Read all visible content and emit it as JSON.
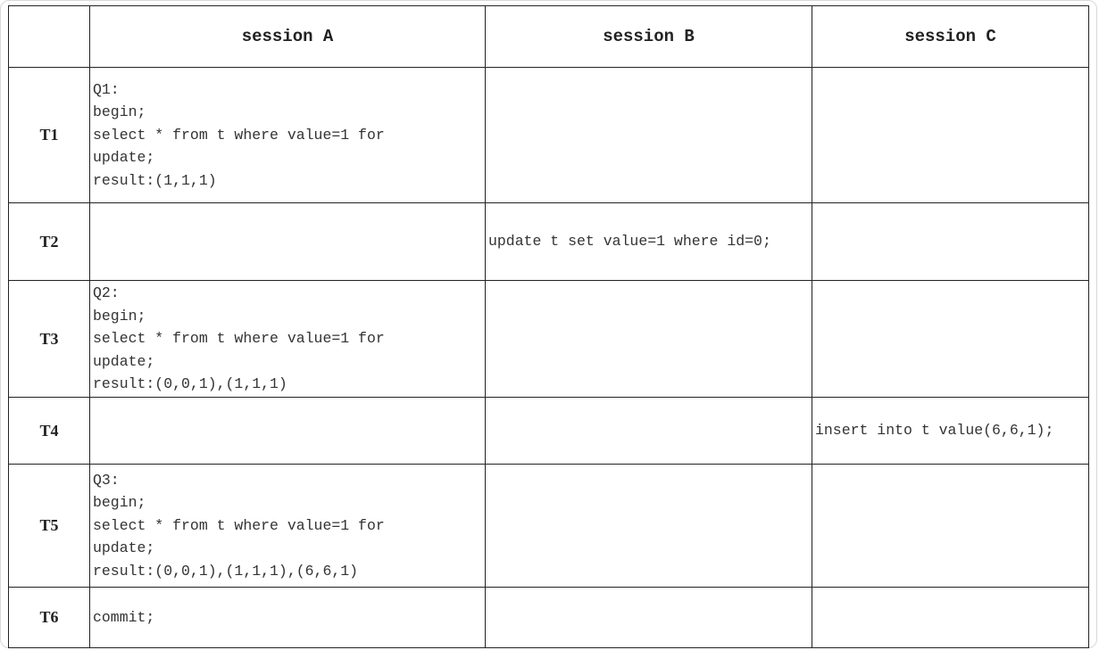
{
  "headers": [
    "",
    "session A",
    "session B",
    "session C"
  ],
  "rows": [
    {
      "time": "T1",
      "a": "Q1:\nbegin;\nselect * from t where value=1 for\nupdate;\nresult:(1,1,1)",
      "b": "",
      "c": ""
    },
    {
      "time": "T2",
      "a": "",
      "b": "update t set value=1 where id=0;",
      "c": ""
    },
    {
      "time": "T3",
      "a": "Q2:\nbegin;\nselect * from t where value=1 for\nupdate;\nresult:(0,0,1),(1,1,1)",
      "b": "",
      "c": ""
    },
    {
      "time": "T4",
      "a": "",
      "b": "",
      "c": "insert into t value(6,6,1);"
    },
    {
      "time": "T5",
      "a": "Q3:\nbegin;\nselect * from t where value=1 for\nupdate;\nresult:(0,0,1),(1,1,1),(6,6,1)",
      "b": "",
      "c": ""
    },
    {
      "time": "T6",
      "a": "commit;",
      "b": "",
      "c": ""
    }
  ]
}
